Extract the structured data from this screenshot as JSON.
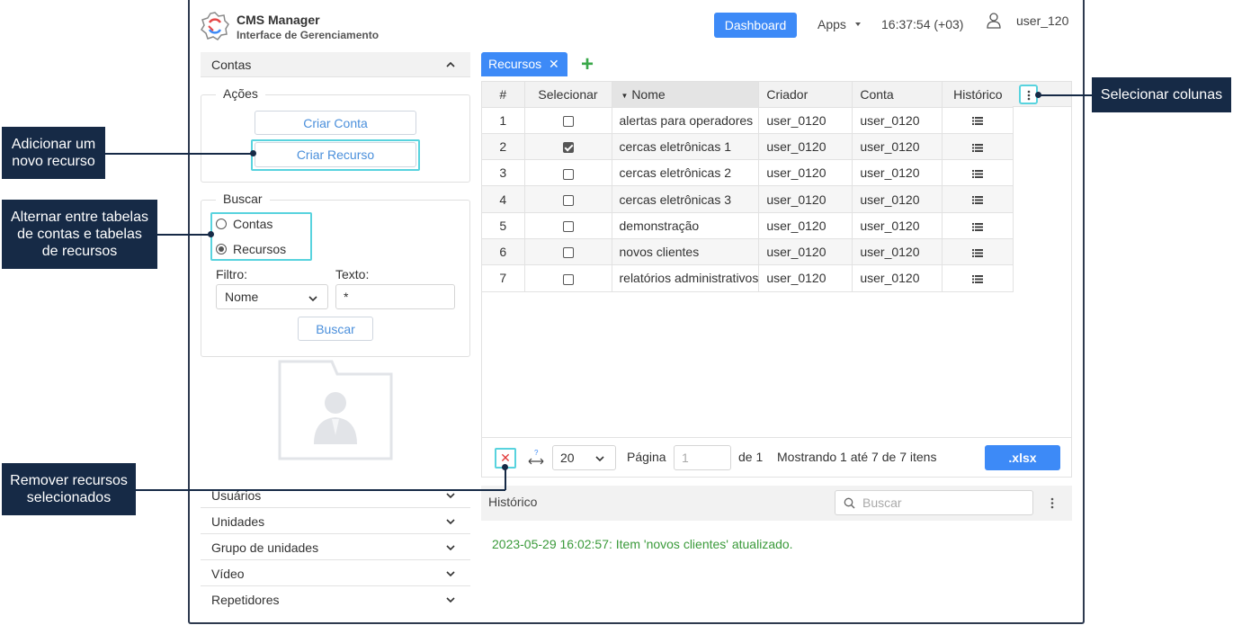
{
  "header": {
    "app_title": "CMS Manager",
    "app_subtitle": "Interface de Gerenciamento",
    "dashboard_label": "Dashboard",
    "apps_label": "Apps",
    "clock": "16:37:54 (+03)",
    "username": "user_120"
  },
  "sidebar": {
    "contas_label": "Contas",
    "acoes_legend": "Ações",
    "criar_conta_label": "Criar Conta",
    "criar_recurso_label": "Criar Recurso",
    "buscar_legend": "Buscar",
    "radio_contas_label": "Contas",
    "radio_recursos_label": "Recursos",
    "radio_selected": "Recursos",
    "filtro_label": "Filtro:",
    "filtro_value": "Nome",
    "texto_label": "Texto:",
    "texto_value": "*",
    "buscar_button_label": "Buscar",
    "sections": [
      {
        "label": "Usuários"
      },
      {
        "label": "Unidades"
      },
      {
        "label": "Grupo de unidades"
      },
      {
        "label": "Vídeo"
      },
      {
        "label": "Repetidores"
      }
    ]
  },
  "tabs": {
    "active_label": "Recursos",
    "add_label": "+"
  },
  "table": {
    "columns": [
      "#",
      "Selecionar",
      "Nome",
      "Criador",
      "Conta",
      "Histórico"
    ],
    "rows": [
      {
        "num": "1",
        "selected": false,
        "nome": "alertas para operadores",
        "criador": "user_0120",
        "conta": "user_0120"
      },
      {
        "num": "2",
        "selected": true,
        "nome": "cercas eletrônicas 1",
        "criador": "user_0120",
        "conta": "user_0120"
      },
      {
        "num": "3",
        "selected": false,
        "nome": "cercas eletrônicas 2",
        "criador": "user_0120",
        "conta": "user_0120"
      },
      {
        "num": "4",
        "selected": false,
        "nome": "cercas eletrônicas 3",
        "criador": "user_0120",
        "conta": "user_0120"
      },
      {
        "num": "5",
        "selected": false,
        "nome": "demonstração",
        "criador": "user_0120",
        "conta": "user_0120"
      },
      {
        "num": "6",
        "selected": false,
        "nome": "novos clientes",
        "criador": "user_0120",
        "conta": "user_0120"
      },
      {
        "num": "7",
        "selected": false,
        "nome": "relatórios administrativos",
        "criador": "user_0120",
        "conta": "user_0120"
      }
    ]
  },
  "pager": {
    "page_size": "20",
    "pagina_label": "Página",
    "page_value": "1",
    "de_label": "de 1",
    "showing": "Mostrando 1 até 7 de 7 itens",
    "xlsx_label": ".xlsx"
  },
  "history": {
    "title": "Histórico",
    "search_placeholder": "Buscar",
    "entry": "2023-05-29 16:02:57: Item 'novos clientes' atualizado."
  },
  "callouts": {
    "adicionar_l1": "Adicionar um",
    "adicionar_l2": "novo recurso",
    "alternar_l1": "Alternar entre tabelas",
    "alternar_l2": "de contas e tabelas",
    "alternar_l3": "de recursos",
    "remover_l1": "Remover recursos",
    "remover_l2": "selecionados",
    "colunas": "Selecionar colunas"
  },
  "colors": {
    "accent": "#3d8af7",
    "highlight": "#58d3de",
    "callout_bg": "#162a46",
    "history_text": "#3a9a3a",
    "add_green": "#3aa84a"
  }
}
